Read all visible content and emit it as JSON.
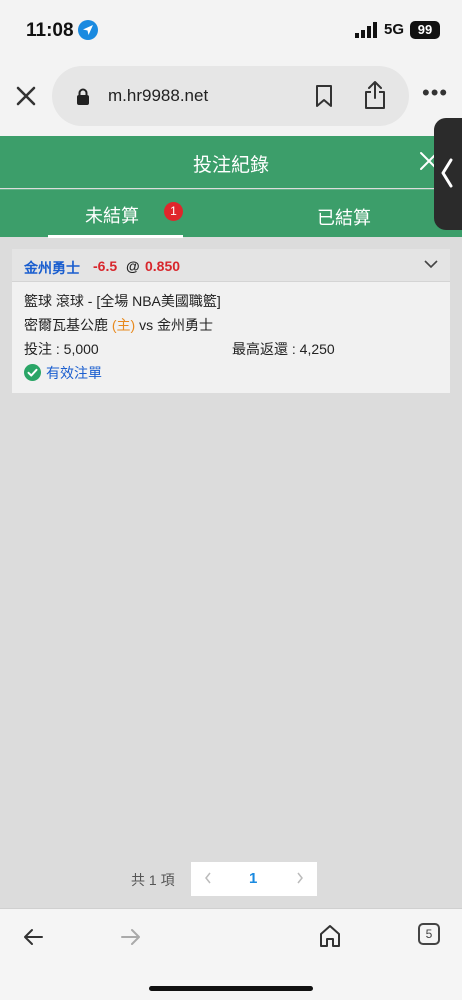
{
  "status_bar": {
    "time": "11:08",
    "network": "5G",
    "battery": "99"
  },
  "browser": {
    "url": "m.hr9988.net"
  },
  "header": {
    "title": "投注紀錄"
  },
  "tabs": [
    {
      "label": "未結算",
      "badge": "1"
    },
    {
      "label": "已結算"
    }
  ],
  "bet": {
    "selection_team": "金州勇士",
    "handicap": "-6.5",
    "at": "@",
    "odds": "0.850",
    "league_line": "籃球 滾球 - [全場 NBA美國職籃]",
    "home_team": "密爾瓦基公鹿",
    "home_tag": "(主)",
    "vs_text": "vs 金州勇士",
    "stake": "投注 : 5,000",
    "max_return": "最高返還 : 4,250",
    "status": "有效注單"
  },
  "pagination": {
    "total": "共 1 項",
    "current": "1"
  },
  "toolbar": {
    "tabs_count": "5"
  },
  "colors": {
    "header_green": "#3c9e6a",
    "link_blue": "#1a5ecf",
    "odds_red": "#d8262c",
    "home_orange": "#e88a1e"
  },
  "icons": [
    "location-arrow-icon",
    "signal-icon",
    "close-icon",
    "lock-icon",
    "bookmark-icon",
    "share-icon",
    "more-icon",
    "chevron-down-icon",
    "check-circle-icon",
    "back-arrow-icon",
    "forward-arrow-icon",
    "home-icon",
    "tabs-icon"
  ]
}
